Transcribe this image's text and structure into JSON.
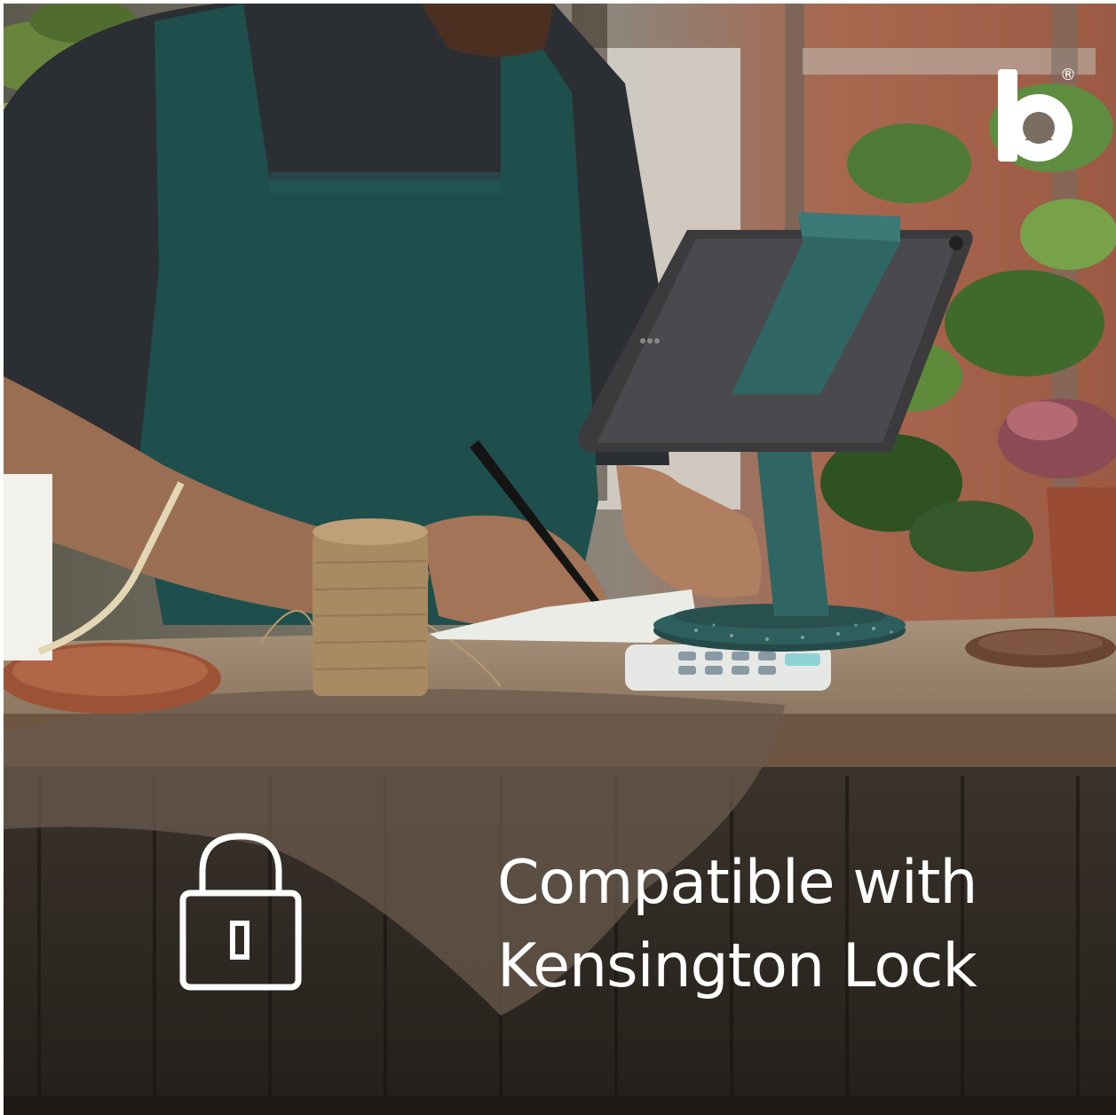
{
  "brand": {
    "logo_letter": "b",
    "registered_mark": "®",
    "icon": "brand-b-logo"
  },
  "feature": {
    "icon": "lock-icon",
    "headline_line1": "Compatible with",
    "headline_line2": "Kensington Lock"
  },
  "colors": {
    "text": "#ffffff",
    "stand": "#2f6663",
    "apron": "#1f4f4d"
  }
}
